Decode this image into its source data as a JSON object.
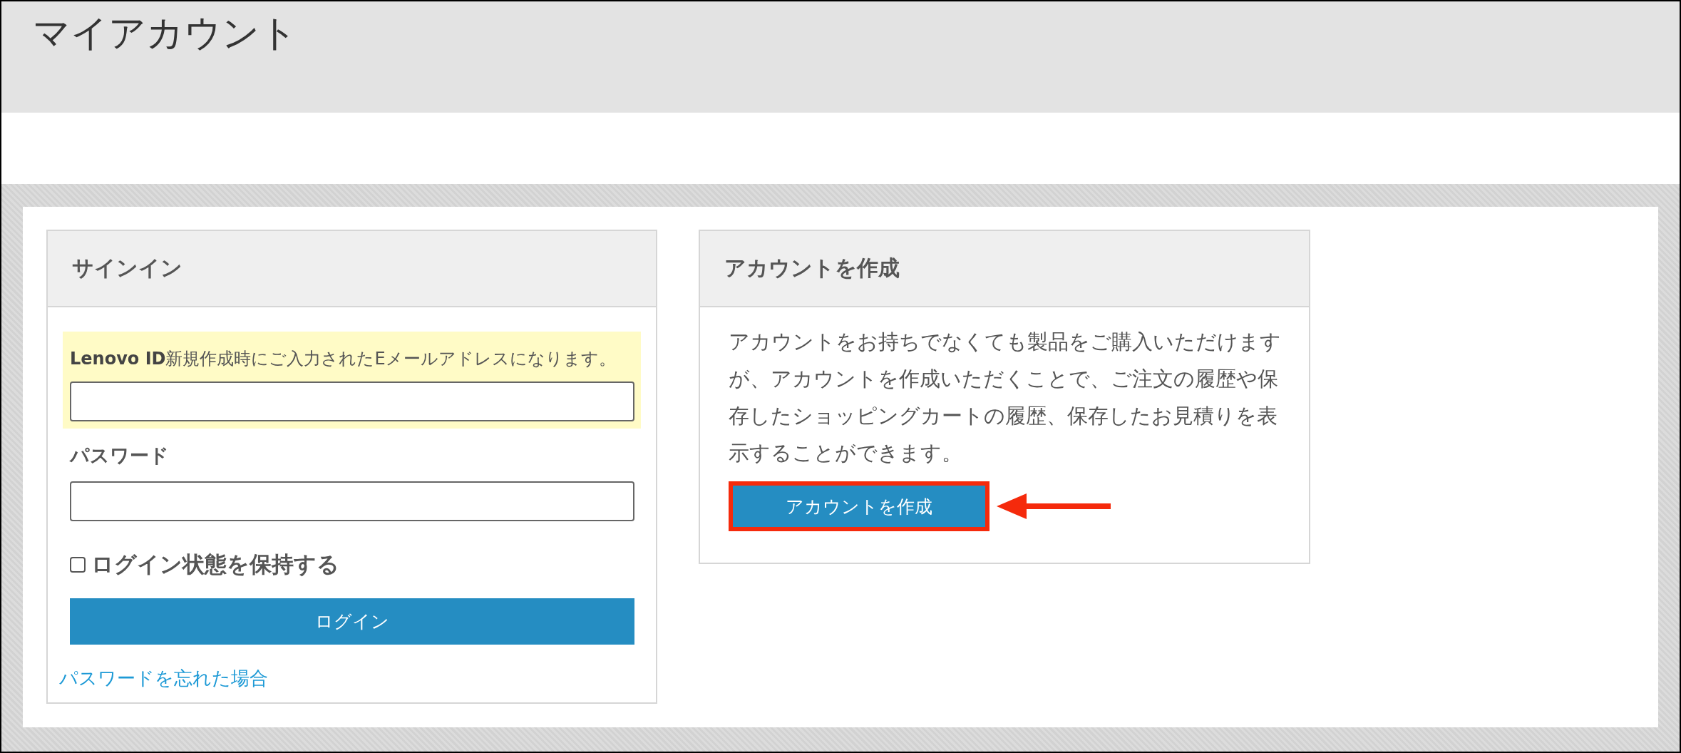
{
  "page": {
    "title": "マイアカウント"
  },
  "sign_in": {
    "heading": "サインイン",
    "email": {
      "label": "**Lenovo ID**新規作成時にご入力されたEメールアドレスになります。"
    },
    "password": {
      "label": "パスワード"
    },
    "remember": {
      "label": "ログイン状態を保持する",
      "checked": false
    },
    "login_button": "ログイン",
    "forgot_link": "パスワードを忘れた場合"
  },
  "create_account": {
    "heading": "アカウントを作成",
    "description": "アカウントをお持ちでなくても製品をご購入いただけますが、アカウントを作成いただくことで、ご注文の履歴や保存したショッピングカートの履歴、保存したお見積りを表示することができます。",
    "button": {
      "label": "アカウントを作成",
      "highlighted": true
    }
  }
}
